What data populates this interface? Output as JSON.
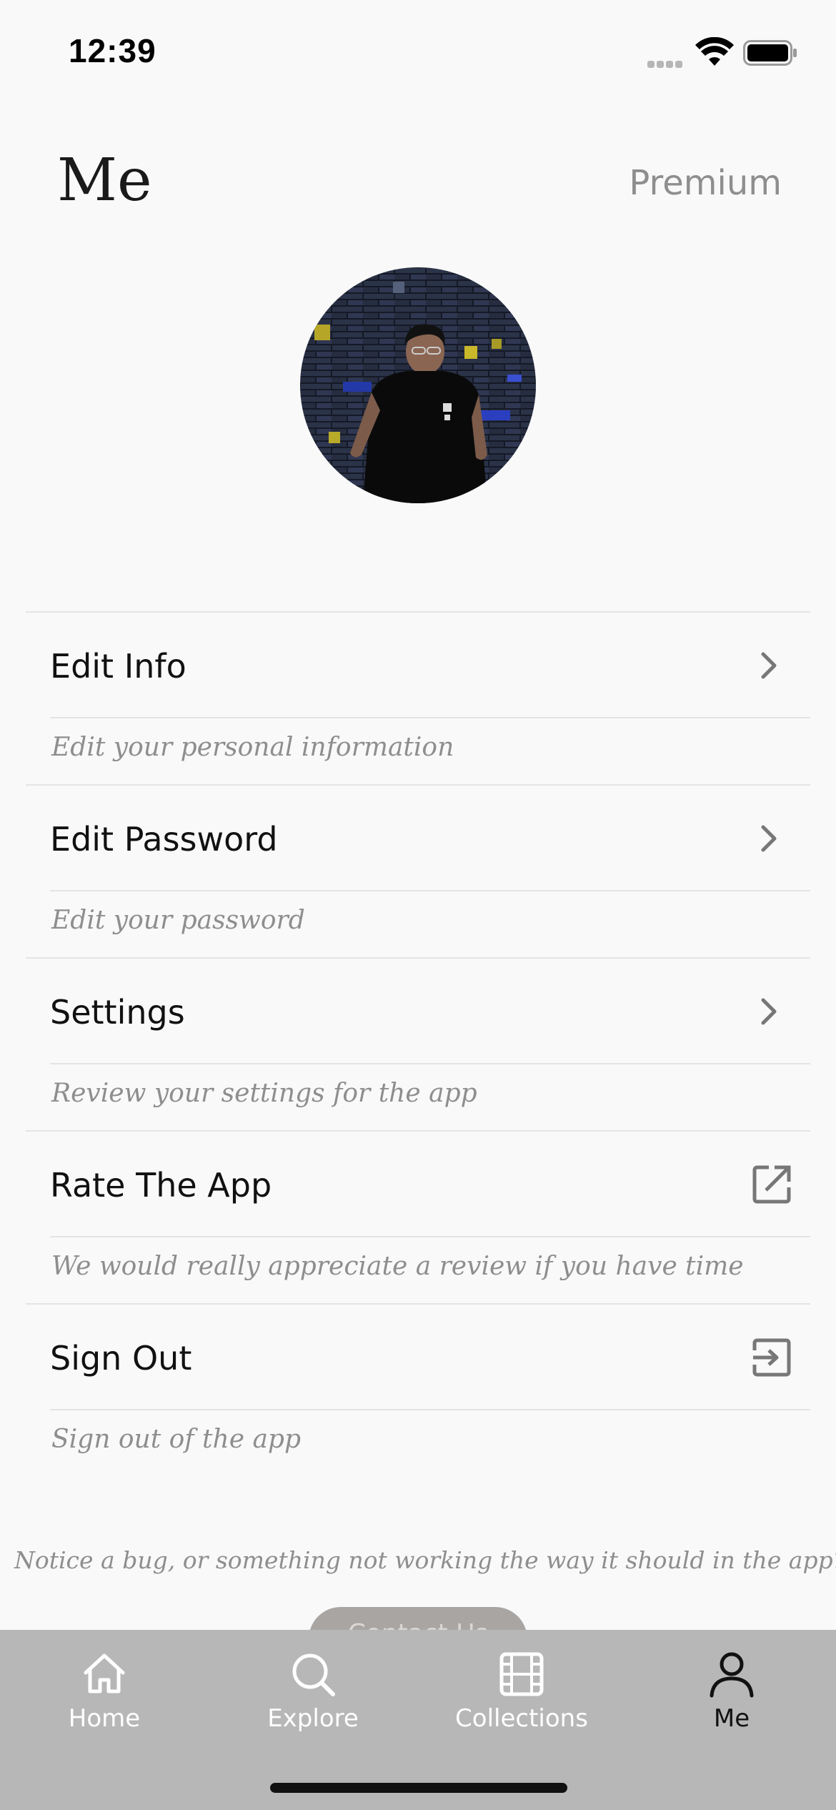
{
  "status_bar": {
    "time": "12:39",
    "icons": [
      "cellular-signal-icon",
      "wifi-icon",
      "battery-icon"
    ]
  },
  "header": {
    "title": "Me",
    "premium_label": "Premium"
  },
  "profile": {
    "avatar": "profile-photo"
  },
  "menu": {
    "items": [
      {
        "label": "Edit Info",
        "description": "Edit your personal information",
        "icon": "chevron-right-icon"
      },
      {
        "label": "Edit Password",
        "description": "Edit your password",
        "icon": "chevron-right-icon"
      },
      {
        "label": "Settings",
        "description": "Review your settings for the app",
        "icon": "chevron-right-icon"
      },
      {
        "label": "Rate The App",
        "description": "We would really appreciate a review if you have time",
        "icon": "external-link-icon"
      },
      {
        "label": "Sign Out",
        "description": "Sign out of the app",
        "icon": "sign-out-icon"
      }
    ]
  },
  "footer": {
    "notice": "Notice a bug, or something not working the way it should in the app?",
    "contact_label": "Contact Us"
  },
  "tab_bar": {
    "tabs": [
      {
        "label": "Home",
        "icon": "home-icon"
      },
      {
        "label": "Explore",
        "icon": "search-icon"
      },
      {
        "label": "Collections",
        "icon": "film-icon"
      },
      {
        "label": "Me",
        "icon": "person-icon"
      }
    ],
    "active": "Me"
  },
  "colors": {
    "background": "#f9f9f9",
    "tab_bar": "#b7b7b7",
    "muted_text": "#8e8e8e",
    "contact_button": "#a9a5a3"
  }
}
